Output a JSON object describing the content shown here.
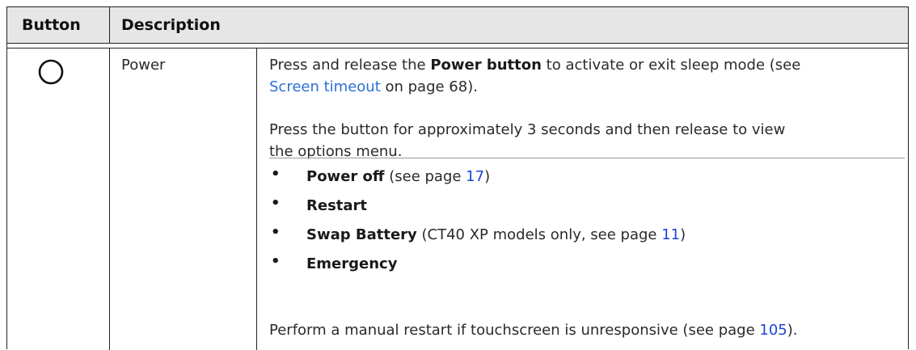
{
  "header": {
    "col_button": "Button",
    "col_description": "Description"
  },
  "row": {
    "button_icon": "power-circle-icon",
    "name": "Power",
    "p1": {
      "t1": "Press and release the ",
      "bold": "Power button",
      "t2": " to activate or exit sleep mode (see",
      "link": "Screen timeout",
      "t3": " on page 68)."
    },
    "p2_line1": "Press the button for approximately 3 seconds and then release to view",
    "p2_line2": "the options menu.",
    "bullet_char": "•",
    "options": [
      {
        "bold": "Power off",
        "text": " (see page ",
        "link": "17",
        "tail": ")"
      },
      {
        "bold": "Restart"
      },
      {
        "bold": "Swap Battery",
        "text": " (CT40 XP models only, see page ",
        "link": "11",
        "tail": ")"
      },
      {
        "bold": "Emergency"
      }
    ],
    "p3": {
      "text": "Perform a manual restart if touchscreen is unresponsive (see page ",
      "link": "105",
      "tail": ")."
    }
  }
}
